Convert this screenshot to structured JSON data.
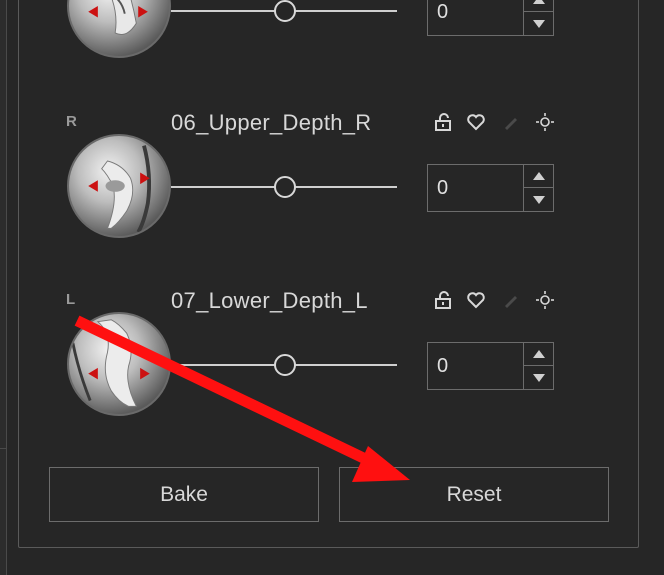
{
  "rows": [
    {
      "side": "",
      "title": "",
      "value": "0"
    },
    {
      "side": "R",
      "title": "06_Upper_Depth_R",
      "value": "0"
    },
    {
      "side": "L",
      "title": "07_Lower_Depth_L",
      "value": "0"
    }
  ],
  "buttons": {
    "bake": "Bake",
    "reset": "Reset"
  },
  "icons": [
    "unlock-icon",
    "heart-icon",
    "pencil-icon",
    "sun-icon"
  ],
  "colors": {
    "background": "#262626",
    "border": "#6c6c6c",
    "text": "#d8d8d8",
    "annotation_arrow": "#ff1010",
    "marker": "#cc1111"
  },
  "slider_level": 0.5
}
